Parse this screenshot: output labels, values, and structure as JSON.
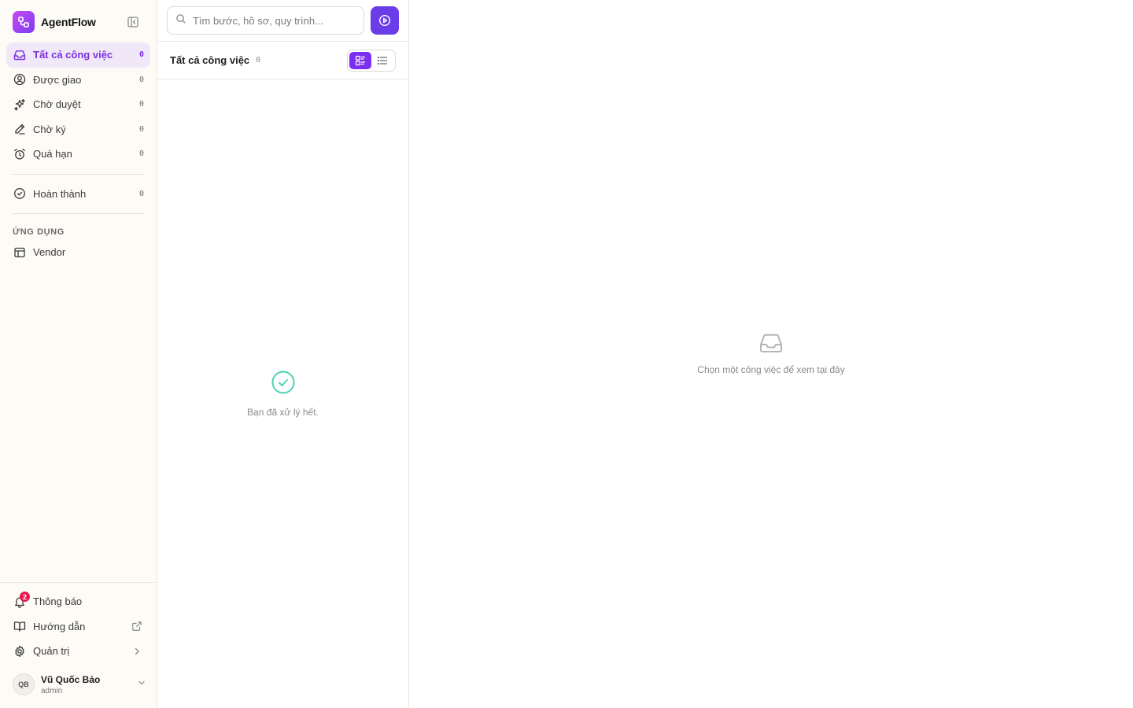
{
  "brand": {
    "name": "AgentFlow"
  },
  "nav": {
    "items": [
      {
        "label": "Tất cả công việc",
        "count": "0"
      },
      {
        "label": "Được giao",
        "count": "0"
      },
      {
        "label": "Chờ duyệt",
        "count": "0"
      },
      {
        "label": "Chờ ký",
        "count": "0"
      },
      {
        "label": "Quá hạn",
        "count": "0"
      },
      {
        "label": "Hoàn thành",
        "count": "0"
      }
    ],
    "apps_section": "ỨNG DỤNG",
    "apps": [
      {
        "label": "Vendor"
      }
    ]
  },
  "bottom": {
    "notifications": {
      "label": "Thông báo",
      "badge": "2"
    },
    "guide": {
      "label": "Hướng dẫn"
    },
    "admin": {
      "label": "Quản trị"
    }
  },
  "user": {
    "initials": "QB",
    "name": "Vũ Quốc Bảo",
    "role": "admin"
  },
  "search": {
    "placeholder": "Tìm bước, hồ sơ, quy trình..."
  },
  "list": {
    "title": "Tất cả công việc",
    "count": "0",
    "empty_message": "Bạn đã xử lý hết."
  },
  "detail": {
    "empty_message": "Chọn một công việc để xem tại đây"
  },
  "colors": {
    "accent": "#7b2ff0",
    "run_button": "#6a3de8",
    "success": "#4fd1b5",
    "badge": "#e5174f"
  }
}
